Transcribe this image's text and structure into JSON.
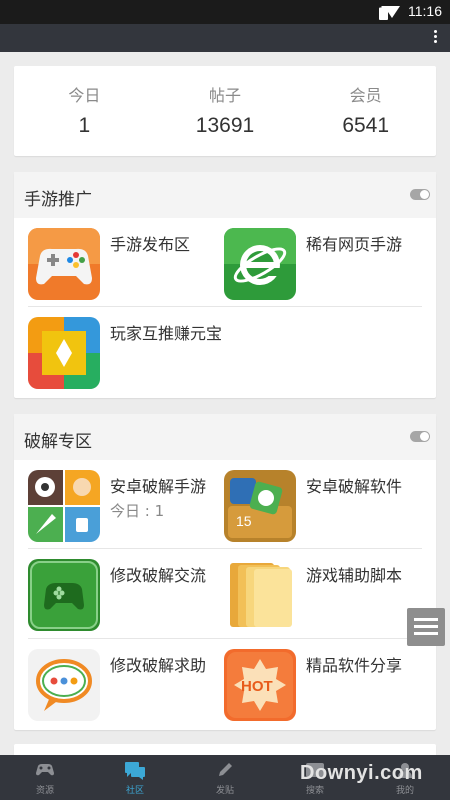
{
  "status_bar": {
    "time": "11:16"
  },
  "stats": [
    {
      "label": "今日",
      "value": "1"
    },
    {
      "label": "帖子",
      "value": "13691"
    },
    {
      "label": "会员",
      "value": "6541"
    }
  ],
  "sections": [
    {
      "title": "手游推广",
      "items": [
        {
          "name": "手游发布区",
          "icon": "gamepad-icon"
        },
        {
          "name": "稀有网页手游",
          "icon": "browser-e-icon"
        },
        {
          "name": "玩家互推赚元宝",
          "icon": "colorful-blocks-icon"
        }
      ]
    },
    {
      "title": "破解专区",
      "items": [
        {
          "name": "安卓破解手游",
          "sub": "今日 : 1",
          "icon": "game-collage-icon"
        },
        {
          "name": "安卓破解软件",
          "icon": "app-box-icon"
        },
        {
          "name": "修改破解交流",
          "icon": "green-gamepad-icon"
        },
        {
          "name": "游戏辅助脚本",
          "icon": "folder-icon"
        },
        {
          "name": "修改破解求助",
          "icon": "chat-bubble-icon"
        },
        {
          "name": "精品软件分享",
          "icon": "hot-badge-icon"
        }
      ]
    }
  ],
  "bottom_nav": [
    {
      "label": "资源",
      "icon": "gamepad-icon"
    },
    {
      "label": "社区",
      "icon": "chat-icon",
      "active": true
    },
    {
      "label": "发贴",
      "icon": "pencil-icon"
    },
    {
      "label": "搜索",
      "icon": "search-icon"
    },
    {
      "label": "我的",
      "icon": "person-icon"
    }
  ],
  "watermark": "Downyi.com",
  "colors": {
    "app_bar": "#33363d",
    "accent": "#3ca8d6",
    "background": "#ececec"
  }
}
